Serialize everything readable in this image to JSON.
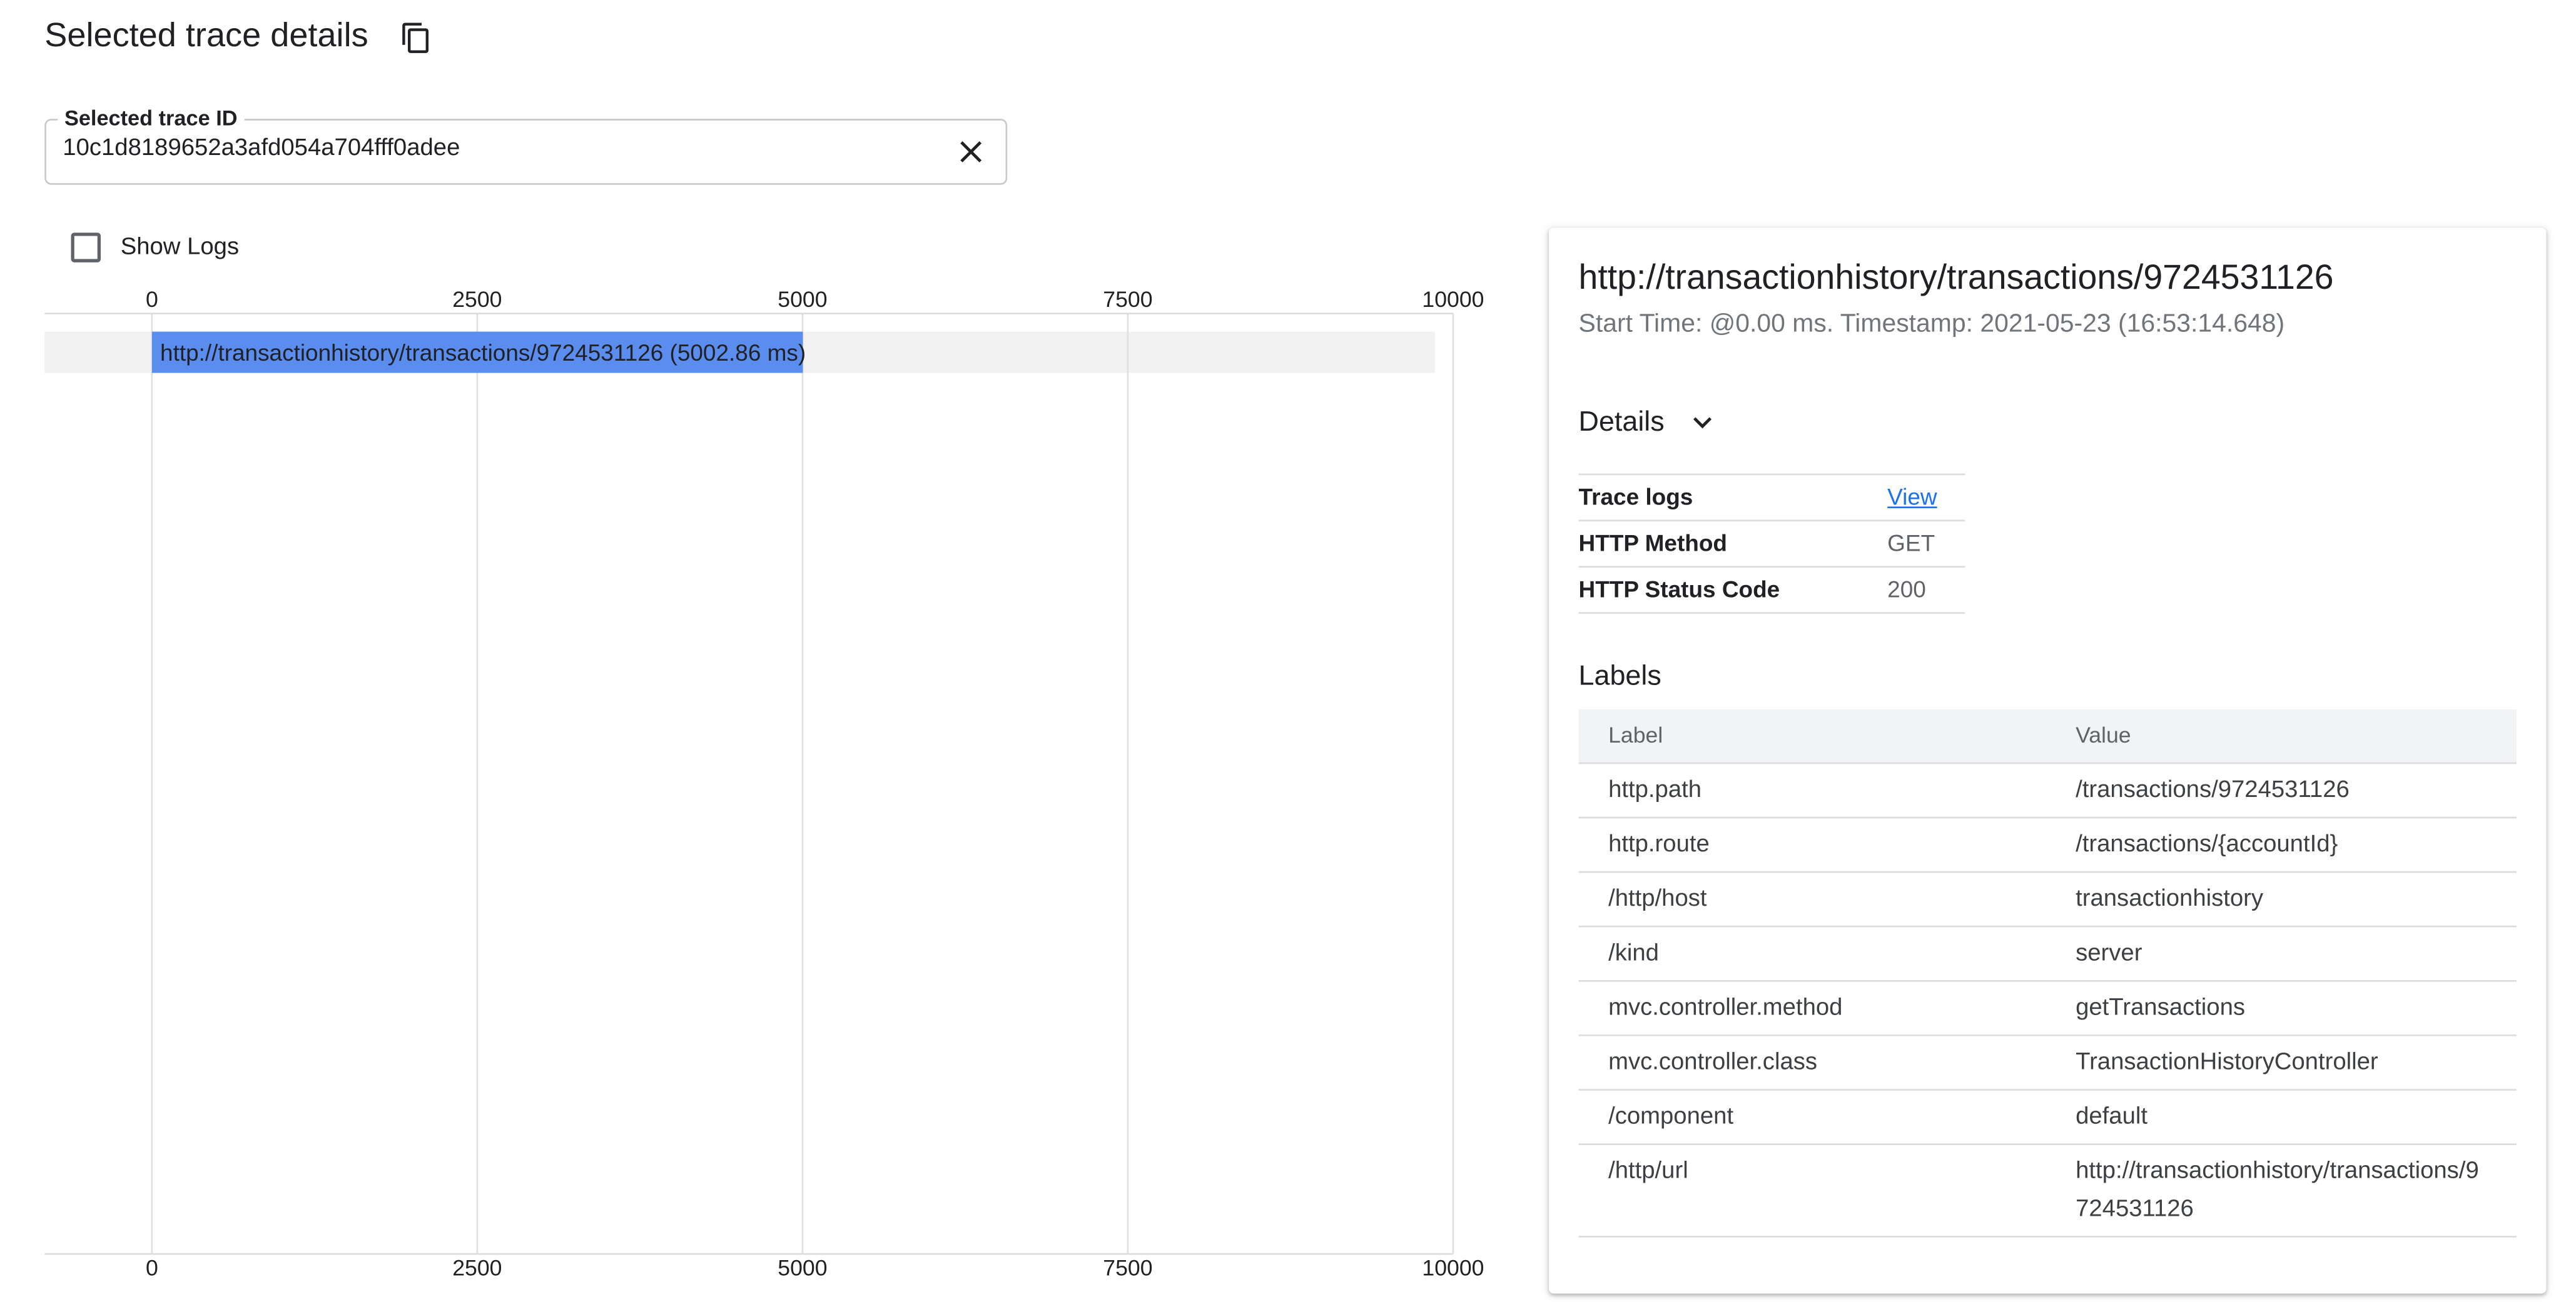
{
  "header": {
    "title": "Selected trace details",
    "copy_icon": "copy-icon"
  },
  "trace_field": {
    "label": "Selected trace ID",
    "value": "10c1d8189652a3afd054a704fff0adee",
    "clear_icon": "close-icon"
  },
  "show_logs": {
    "label": "Show Logs",
    "checked": false
  },
  "chart_data": {
    "type": "bar",
    "orientation": "horizontal",
    "x_ticks": [
      "0",
      "2500",
      "5000",
      "7500",
      "10000"
    ],
    "xlim": [
      0,
      10000
    ],
    "grid": true,
    "bar_color": "#5b8def",
    "spans": [
      {
        "start": 0,
        "duration": 5002.86,
        "label": "http://transactionhistory/transactions/9724531126 (5002.86 ms)"
      }
    ]
  },
  "details_panel": {
    "span_title": "http://transactionhistory/transactions/9724531126",
    "span_subtitle": "Start Time: @0.00 ms. Timestamp: 2021-05-23 (16:53:14.648)",
    "details_label": "Details",
    "details_rows": [
      {
        "key": "Trace logs",
        "value": "View"
      },
      {
        "key": "HTTP Method",
        "value": "GET"
      },
      {
        "key": "HTTP Status Code",
        "value": "200"
      }
    ],
    "labels_heading": "Labels",
    "labels_columns": [
      "Label",
      "Value"
    ],
    "labels": [
      {
        "label": "http.path",
        "value": "/transactions/9724531126"
      },
      {
        "label": "http.route",
        "value": "/transactions/{accountId}"
      },
      {
        "label": "/http/host",
        "value": "transactionhistory"
      },
      {
        "label": "/kind",
        "value": "server"
      },
      {
        "label": "mvc.controller.method",
        "value": "getTransactions"
      },
      {
        "label": "mvc.controller.class",
        "value": "TransactionHistoryController"
      },
      {
        "label": "/component",
        "value": "default"
      },
      {
        "label": "/http/url",
        "value": "http://transactionhistory/transactions/9724531126"
      }
    ]
  },
  "colors": {
    "accent": "#1a73e8",
    "bar": "#5b8def",
    "header_bg": "#f1f3f4"
  }
}
